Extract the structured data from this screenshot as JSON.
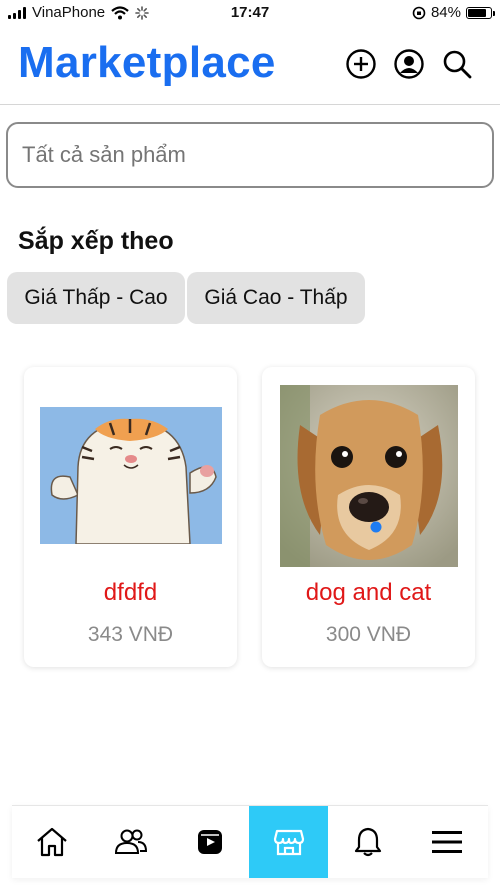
{
  "status": {
    "carrier": "VinaPhone",
    "time": "17:47",
    "battery": "84%",
    "battery_level": 0.84
  },
  "header": {
    "title": "Marketplace",
    "icons": [
      "plus-circle-icon",
      "user-circle-icon",
      "search-icon"
    ]
  },
  "search": {
    "placeholder": "Tất cả sản phẩm"
  },
  "sort": {
    "title": "Sắp xếp theo",
    "options": [
      "Giá Thấp - Cao",
      "Giá Cao - Thấp"
    ]
  },
  "products": [
    {
      "name": "dfdfd",
      "price": "343 VNĐ",
      "image": "tiger-illustration"
    },
    {
      "name": "dog and cat",
      "price": "300 VNĐ",
      "image": "puppy-photo"
    }
  ],
  "nav": {
    "items": [
      "home-icon",
      "friends-icon",
      "video-icon",
      "store-icon",
      "bell-icon",
      "menu-icon"
    ],
    "active_index": 3
  },
  "colors": {
    "title": "#1a6ef0",
    "product_name": "#e01818",
    "active_tab": "#2ecaf7",
    "chip": "#e2e2e2"
  }
}
